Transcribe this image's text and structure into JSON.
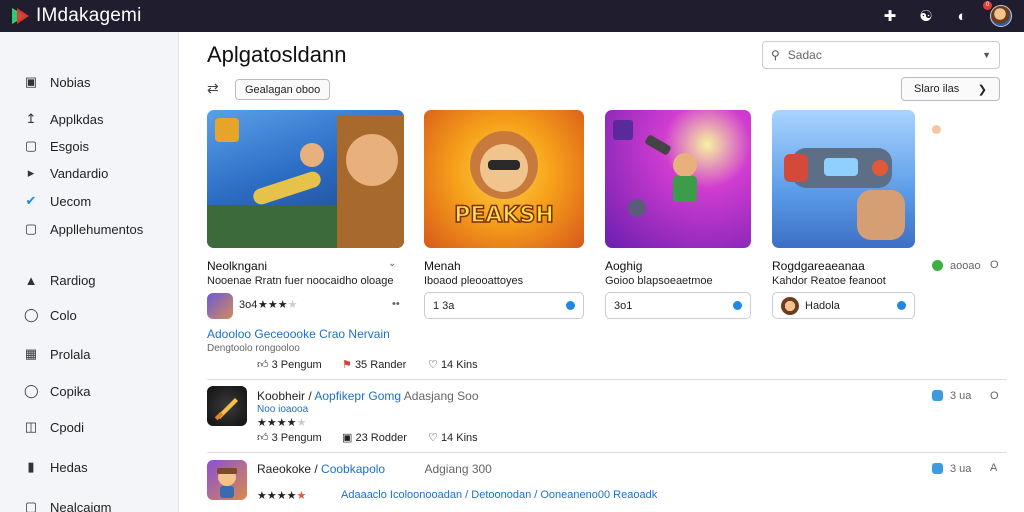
{
  "app": {
    "title": "IMdakagemi"
  },
  "topbar": {
    "icons": [
      "person-add-icon",
      "bell-icon",
      "contrast-icon",
      "avatar"
    ],
    "notification_count": "0"
  },
  "sidebar": {
    "items": [
      {
        "label": "Nobias",
        "icon": "square-icon"
      },
      {
        "label": "Applkdas",
        "icon": "upload-icon"
      },
      {
        "label": "Esgois",
        "icon": "square-icon"
      },
      {
        "label": "Vandardio",
        "icon": "tag-icon"
      },
      {
        "label": "Uecom",
        "icon": "shield-icon",
        "active": true
      },
      {
        "label": "Appllehumentos",
        "icon": "square-icon"
      },
      {
        "label": "Rardiog",
        "icon": "upload-icon"
      },
      {
        "label": "Colo",
        "icon": "circle-icon"
      },
      {
        "label": "Prolala",
        "icon": "grid-icon"
      },
      {
        "label": "Copika",
        "icon": "circle-icon"
      },
      {
        "label": "Cpodi",
        "icon": "window-icon"
      },
      {
        "label": "Hedas",
        "icon": "bar-icon"
      },
      {
        "label": "Nealcaigm",
        "icon": "square-icon"
      }
    ]
  },
  "main": {
    "title": "Aplgatosldann",
    "search_placeholder": "Sadac",
    "filter_chip": "Gealagan   oboo",
    "sort_label": "Slaro ilas",
    "cards": [
      {
        "title": "Neolkngani",
        "subtitle": "Nooenae Rratn fuer noocaidho oloage",
        "field": "3o4",
        "rating": 3.5,
        "colors": [
          "#2b6cc4",
          "#e0a040"
        ]
      },
      {
        "title": "Menah",
        "subtitle": "Iboaod pleooattoyes",
        "field": "1 3a",
        "rating": 0,
        "colors": [
          "#f6a019",
          "#e0531c"
        ]
      },
      {
        "title": "Aoghig",
        "subtitle": "Goioo blapsoeaetmoe",
        "field": "3o1",
        "rating": 0,
        "colors": [
          "#8a2bd0",
          "#d13cd0"
        ]
      },
      {
        "title": "Rogdgareaeanaa",
        "subtitle": "Kahdor Reatoe feanoot",
        "field": "Hadola",
        "rating": 0,
        "colors": [
          "#3d8fe0",
          "#a9d4ff"
        ]
      }
    ],
    "card_side": {
      "label": "aooao",
      "value": "O"
    },
    "row1": {
      "link": "Adooloo Geceoooke Crao Nervain",
      "sub": "Dengtoolo rongooloo",
      "stats": [
        {
          "icon": "thumb-up-icon",
          "count": "3",
          "label": "Pengum"
        },
        {
          "icon": "flag-icon",
          "count": "35",
          "label": "Rander"
        },
        {
          "icon": "heart-icon",
          "count": "14",
          "label": "Kins"
        }
      ]
    },
    "list": [
      {
        "title": "Koobheir /",
        "link": "Aopfikepr Gomg",
        "extra": "Adasjang Soo",
        "sub": "Noo ioaooa",
        "stats": [
          {
            "icon": "thumb-up-icon",
            "count": "3",
            "label": "Pengum"
          },
          {
            "icon": "flag-icon",
            "count": "23",
            "label": "Rodder"
          },
          {
            "icon": "heart-icon",
            "count": "14",
            "label": "Kins"
          }
        ],
        "side_label": "3 ua",
        "side_value": "O",
        "badge_color": "#3d9be0"
      },
      {
        "title": "Raeokoke /",
        "link": "Coobkapolo",
        "extra": "Adgiang 300",
        "sub": "Adaaaclo Icoloonooadan / Detoonodan / Ooneaneno00 Reaoadk",
        "side_label": "3 ua",
        "side_value": "A",
        "badge_color": "#3d9be0"
      }
    ]
  }
}
